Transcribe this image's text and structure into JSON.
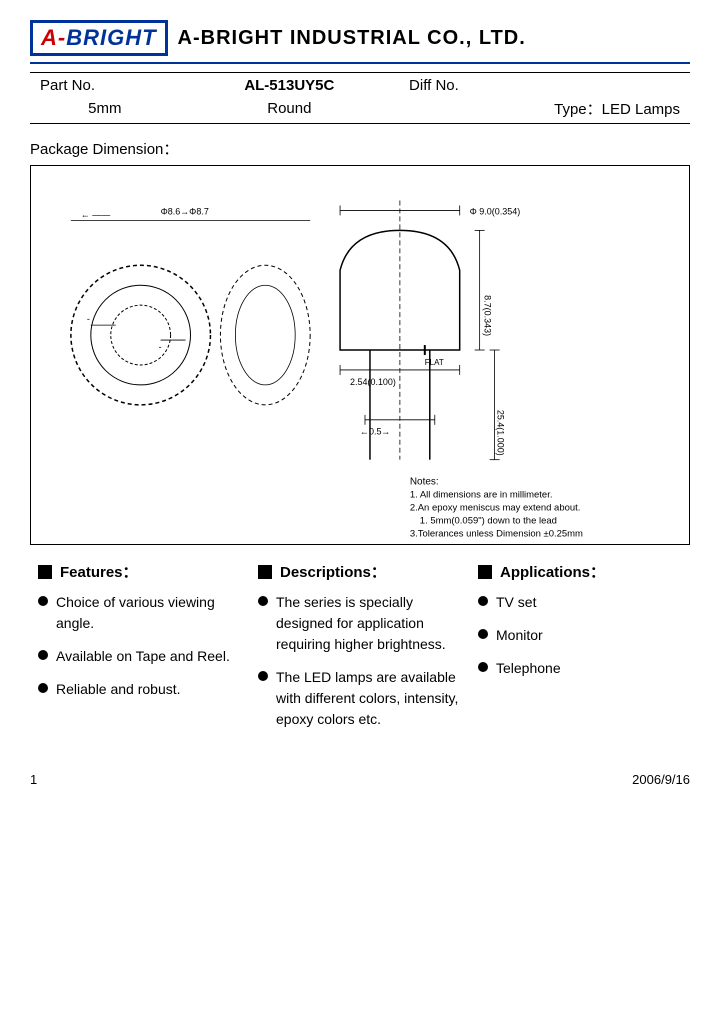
{
  "header": {
    "logo_a": "A-",
    "logo_bright": "BRIGHT",
    "company": "A-BRIGHT INDUSTRIAL CO., LTD."
  },
  "part_info": {
    "row1": {
      "part_no_label": "Part No.",
      "part_no_value": "AL-513UY5C",
      "diff_label": "Diff No."
    },
    "row2": {
      "size": "5mm",
      "shape": "Round",
      "type": "Type：LED Lamps"
    }
  },
  "package": {
    "title": "Package Dimension："
  },
  "notes": {
    "title": "Notes:",
    "items": [
      "1. All dimensions are in millimeter.",
      "2.An epoxy meniscus may extend about.",
      "   1. 5mm(0.059\") down to the lead",
      "3.Tolerances unless Dimension ±0.25mm"
    ]
  },
  "features": {
    "header": "Features：",
    "items": [
      "Choice of various viewing angle.",
      "Available on Tape and Reel.",
      "Reliable and robust."
    ]
  },
  "descriptions": {
    "header": "Descriptions：",
    "items": [
      "The series is specially designed for application requiring higher brightness.",
      "The LED lamps are available with different colors, intensity, epoxy colors etc."
    ]
  },
  "applications": {
    "header": "Applications：",
    "items": [
      "TV set",
      "Monitor",
      "Telephone"
    ]
  },
  "footer": {
    "page": "1",
    "date": "2006/9/16"
  }
}
